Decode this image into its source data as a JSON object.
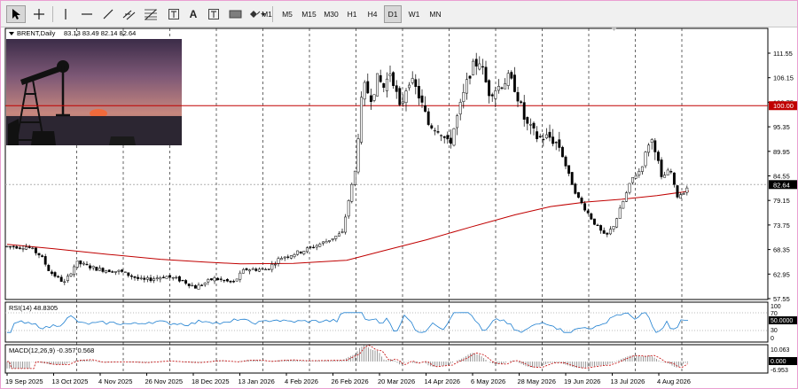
{
  "toolbar": {
    "tools": [
      {
        "name": "cursor-icon",
        "selected": true
      },
      {
        "name": "crosshair-icon"
      },
      {
        "name": "vertical-line-icon"
      },
      {
        "name": "horizontal-line-icon"
      },
      {
        "name": "trendline-icon"
      },
      {
        "name": "equidistant-channel-icon"
      },
      {
        "name": "fibonacci-icon"
      },
      {
        "name": "text-icon",
        "glyph": "A"
      },
      {
        "name": "text-label-icon",
        "glyph": "T"
      },
      {
        "name": "rectangle-label-icon"
      },
      {
        "name": "shapes-dropdown-icon"
      }
    ],
    "timeframes": [
      "M1",
      "M5",
      "M15",
      "M30",
      "H1",
      "H4",
      "D1",
      "W1",
      "MN"
    ],
    "active_timeframe": "D1"
  },
  "chart": {
    "symbol_label": "BRENT,Daily",
    "ohlc_text": "83.13 83.49 82.14 82.64",
    "current_price": "82.64",
    "hline_level": "100.00",
    "price_ticks": [
      "111.55",
      "106.15",
      "100.75",
      "95.35",
      "89.95",
      "84.55",
      "79.15",
      "73.75",
      "68.35",
      "62.95",
      "57.55"
    ],
    "date_labels": [
      "19 Sep 2025",
      "13 Oct 2025",
      "4 Nov 2025",
      "26 Nov 2025",
      "18 Dec 2025",
      "13 Jan 2026",
      "4 Feb 2026",
      "26 Feb 2026",
      "20 Mar 2026",
      "14 Apr 2026",
      "6 May 2026",
      "28 May 2026",
      "19 Jun 2026",
      "13 Jul 2026",
      "4 Aug 2026"
    ],
    "colors": {
      "candles": "#000000",
      "ma": "#c00000",
      "hline": "#c00000",
      "rsi": "#1e7fd0",
      "macd_signal": "#c00000",
      "macd_hist": "#808080",
      "label_bg": "#000000",
      "hline_label_bg": "#c00000"
    }
  },
  "rsi": {
    "label": "RSI(14) 48.8305",
    "ticks": [
      "100",
      "70",
      "30",
      "0"
    ],
    "current": "50.0000"
  },
  "macd": {
    "label": "MACD(12,26,9) -0.357 0.568",
    "ticks": [
      "10.063",
      "-6.953"
    ],
    "current": "0.000"
  }
}
